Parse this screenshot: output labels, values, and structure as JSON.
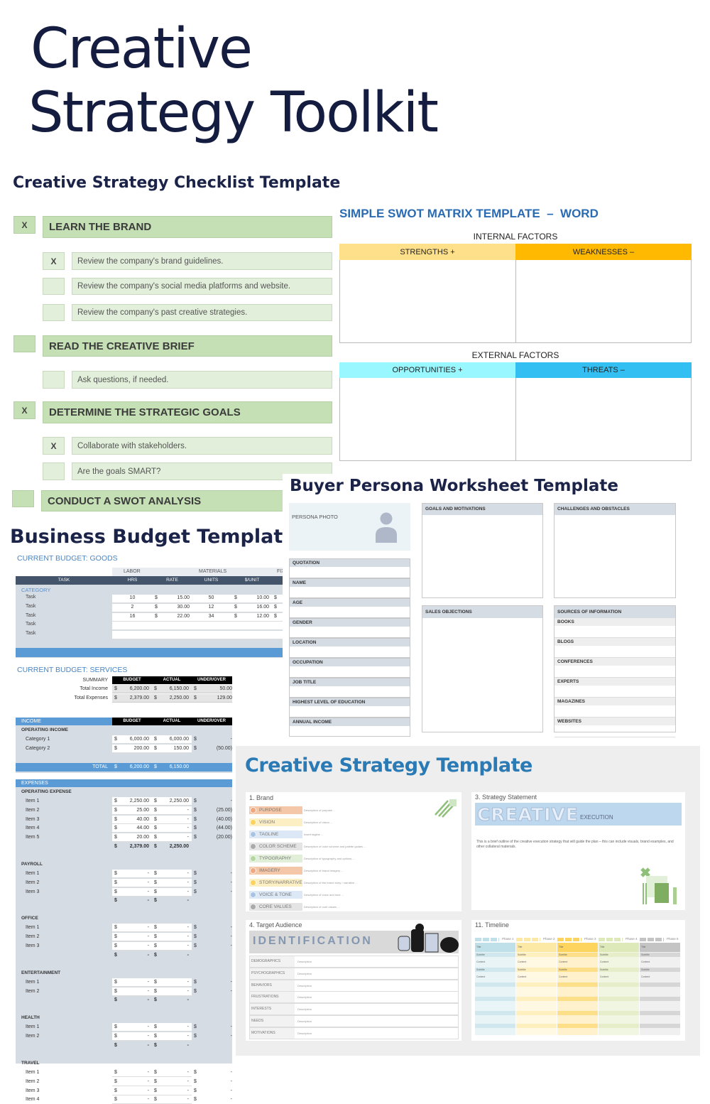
{
  "hero": {
    "line1": "Creative",
    "line2": "Strategy Toolkit"
  },
  "checklist": {
    "title": "Creative Strategy Checklist Template",
    "sections": [
      {
        "label": "LEARN THE BRAND",
        "checked": "X",
        "tasks": [
          {
            "label": "Review the company's brand guidelines.",
            "checked": "X"
          },
          {
            "label": "Review the company's social media platforms and website.",
            "checked": ""
          },
          {
            "label": "Review the company's past creative strategies.",
            "checked": ""
          }
        ]
      },
      {
        "label": "READ THE CREATIVE BRIEF",
        "checked": "",
        "tasks": [
          {
            "label": "Ask questions, if needed.",
            "checked": ""
          }
        ]
      },
      {
        "label": "DETERMINE THE STRATEGIC GOALS",
        "checked": "X",
        "tasks": [
          {
            "label": "Collaborate with stakeholders.",
            "checked": "X"
          },
          {
            "label": "Are the goals SMART?",
            "checked": ""
          }
        ]
      },
      {
        "label": "CONDUCT A SWOT ANALYSIS",
        "checked": "",
        "tasks": []
      }
    ]
  },
  "swot": {
    "title": "SIMPLE SWOT MATRIX TEMPLATE  –  WORD",
    "internal": "INTERNAL FACTORS",
    "external": "EXTERNAL FACTORS",
    "strengths": "STRENGTHS  +",
    "weaknesses": "WEAKNESSES  –",
    "opportunities": "OPPORTUNITIES  +",
    "threats": "THREATS  –",
    "colors": {
      "strengths": "#ffe08a",
      "weaknesses": "#ffb900",
      "opportunities": "#99f7ff",
      "threats": "#33bff2"
    }
  },
  "persona": {
    "title": "Buyer Persona Worksheet Template",
    "photo": "PERSONA PHOTO",
    "fields": [
      "QUOTATION",
      "NAME",
      "AGE",
      "GENDER",
      "LOCATION",
      "OCCUPATION",
      "JOB TITLE",
      "HIGHEST LEVEL OF EDUCATION",
      "ANNUAL INCOME"
    ],
    "goals": "GOALS AND MOTIVATIONS",
    "challenges": "CHALLENGES AND OBSTACLES",
    "objections": "SALES OBJECTIONS",
    "sources": "SOURCES OF INFORMATION",
    "source_items": [
      "BOOKS",
      "BLOGS",
      "CONFERENCES",
      "EXPERTS",
      "MAGAZINES",
      "WEBSITES"
    ]
  },
  "budget": {
    "title": "Business Budget Template",
    "goods_title": "CURRENT BUDGET: GOODS",
    "goods_groups": {
      "labor": "LABOR",
      "materials": "MATERIALS",
      "fixed": "FIX"
    },
    "goods_headers": [
      "TASK",
      "HRS",
      "RATE",
      "UNITS",
      "$/UNIT"
    ],
    "category": "CATEGORY",
    "goods_rows": [
      [
        "Task",
        "10",
        "15.00",
        "50",
        "10.00"
      ],
      [
        "Task",
        "2",
        "30.00",
        "12",
        "16.00"
      ],
      [
        "Task",
        "16",
        "22.00",
        "34",
        "12.00"
      ],
      [
        "Task",
        "",
        "",
        "",
        ""
      ],
      [
        "Task",
        "",
        "",
        "",
        ""
      ]
    ],
    "services_title": "CURRENT BUDGET: SERVICES",
    "summary_label": "SUMMARY",
    "col_headers": [
      "BUDGET",
      "ACTUAL",
      "UNDER/OVER"
    ],
    "summary_rows": [
      [
        "Total Income",
        "6,200.00",
        "6,150.00",
        "50.00"
      ],
      [
        "Total Expenses",
        "2,379.00",
        "2,250.00",
        "129.00"
      ]
    ],
    "income_label": "INCOME",
    "operating_income": "OPERATING INCOME",
    "income_rows": [
      [
        "Category 1",
        "6,000.00",
        "6,000.00",
        "-"
      ],
      [
        "Category 2",
        "200.00",
        "150.00",
        "(50.00)"
      ]
    ],
    "income_total": [
      "TOTAL",
      "6,200.00",
      "6,150.00"
    ],
    "expenses_label": "EXPENSES",
    "expense_groups": [
      {
        "name": "OPERATING EXPENSE",
        "rows": [
          [
            "Item 1",
            "2,250.00",
            "2,250.00",
            "-"
          ],
          [
            "Item 2",
            "25.00",
            "-",
            "(25.00)"
          ],
          [
            "Item 3",
            "40.00",
            "-",
            "(40.00)"
          ],
          [
            "Item 4",
            "44.00",
            "-",
            "(44.00)"
          ],
          [
            "Item 5",
            "20.00",
            "-",
            "(20.00)"
          ]
        ],
        "total": [
          "2,379.00",
          "2,250.00"
        ]
      },
      {
        "name": "PAYROLL",
        "rows": [
          [
            "Item 1",
            "-",
            "-",
            "-"
          ],
          [
            "Item 2",
            "-",
            "-",
            "-"
          ],
          [
            "Item 3",
            "-",
            "-",
            "-"
          ]
        ],
        "total": [
          "-",
          "-"
        ]
      },
      {
        "name": "OFFICE",
        "rows": [
          [
            "Item 1",
            "-",
            "-",
            "-"
          ],
          [
            "Item 2",
            "-",
            "-",
            "-"
          ],
          [
            "Item 3",
            "-",
            "-",
            "-"
          ]
        ],
        "total": [
          "-",
          "-"
        ]
      },
      {
        "name": "ENTERTAINMENT",
        "rows": [
          [
            "Item 1",
            "-",
            "-",
            "-"
          ],
          [
            "Item 2",
            "-",
            "-",
            "-"
          ]
        ],
        "total": [
          "-",
          "-"
        ]
      },
      {
        "name": "HEALTH",
        "rows": [
          [
            "Item 1",
            "-",
            "-",
            "-"
          ],
          [
            "Item 2",
            "-",
            "-",
            "-"
          ]
        ],
        "total": [
          "-",
          "-"
        ]
      },
      {
        "name": "TRAVEL",
        "rows": [
          [
            "Item 1",
            "-",
            "-",
            "-"
          ],
          [
            "Item 2",
            "-",
            "-",
            "-"
          ],
          [
            "Item 3",
            "-",
            "-",
            "-"
          ],
          [
            "Item 4",
            "-",
            "-",
            "-"
          ]
        ],
        "total": null
      }
    ],
    "currency": "$"
  },
  "cst": {
    "title": "Creative Strategy Template",
    "brand": {
      "heading": "1. Brand",
      "items": [
        {
          "label": "PURPOSE",
          "desc": "Description of purpose ...",
          "color": "#f4c7a8",
          "dot": "#f0a880"
        },
        {
          "label": "VISION",
          "desc": "Description of vision ...",
          "color": "#fdefc4",
          "dot": "#fcd25a"
        },
        {
          "label": "TAGLINE",
          "desc": "Insert tagline ...",
          "color": "#dce8f5",
          "dot": "#a8c4e4"
        },
        {
          "label": "COLOR SCHEME",
          "desc": "Description of color scheme and palette guides ...",
          "color": "#e4e4e4",
          "dot": "#aaaaaa"
        },
        {
          "label": "TYPOGRAPHY",
          "desc": "Description of typography and options ...",
          "color": "#e1efd9",
          "dot": "#b4d6a0"
        },
        {
          "label": "IMAGERY",
          "desc": "Description of brand imagery ...",
          "color": "#f4c7a8",
          "dot": "#f0a880"
        },
        {
          "label": "STORY/NARRATIVE",
          "desc": "Description of the brand story / narrative ...",
          "color": "#fdefc4",
          "dot": "#fcd25a"
        },
        {
          "label": "VOICE & TONE",
          "desc": "Description of voice and tone ...",
          "color": "#dce8f5",
          "dot": "#a8c4e4"
        },
        {
          "label": "CORE VALUES",
          "desc": "Description of core values ...",
          "color": "#e4e4e4",
          "dot": "#aaaaaa"
        }
      ]
    },
    "strategy": {
      "heading": "3. Strategy Statement",
      "big": "CREATIVE",
      "small": "EXECUTION",
      "body": "This is a brief outline of the creative execution strategy that will guide the plan – this can include visuals, brand examples, and other collateral materials."
    },
    "audience": {
      "heading": "4. Target Audience",
      "banner": "IDENTIFICATION",
      "rows": [
        [
          "DEMOGRAPHICS",
          "Description"
        ],
        [
          "PSYCHOGRAPHICS",
          "Description"
        ],
        [
          "BEHAVIORS",
          "Description"
        ],
        [
          "FRUSTRATIONS",
          "Description"
        ],
        [
          "INTERESTS",
          "Description"
        ],
        [
          "NEEDS",
          "Description"
        ],
        [
          "MOTIVATIONS",
          "Description"
        ]
      ]
    },
    "timeline": {
      "heading": "11. Timeline",
      "phases": [
        {
          "label": "Phase 1",
          "color": "#bfe0e8",
          "light": "#e8f4f6"
        },
        {
          "label": "Phase 2",
          "color": "#fde9a6",
          "light": "#fff8e2"
        },
        {
          "label": "Phase 3",
          "color": "#fcd45e",
          "light": "#fff1cc"
        },
        {
          "label": "Phase 4",
          "color": "#dde9b8",
          "light": "#f0f6e2"
        },
        {
          "label": "Phase 5",
          "color": "#c4c4c4",
          "light": "#f0f0f0"
        }
      ],
      "cells": [
        "Title",
        "Subtitle",
        "Content",
        "Subtitle",
        "Content"
      ]
    }
  }
}
